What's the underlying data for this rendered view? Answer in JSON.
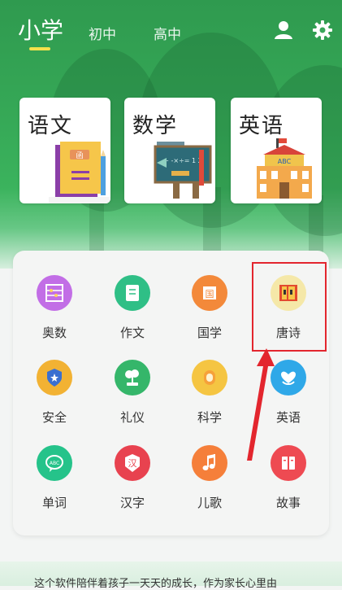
{
  "header": {
    "tabs": [
      {
        "label": "小学",
        "active": true
      },
      {
        "label": "初中",
        "active": false
      },
      {
        "label": "高中",
        "active": false
      }
    ],
    "icons": [
      "user-icon",
      "gear-icon"
    ]
  },
  "subjects": [
    {
      "title": "语文",
      "icon": "books-icon"
    },
    {
      "title": "数学",
      "icon": "blackboard-icon"
    },
    {
      "title": "英语",
      "icon": "school-icon"
    }
  ],
  "book_label": "函",
  "school_sign": "ABC",
  "board_text": "+ -×÷= 1 2",
  "grid": [
    {
      "label": "奥数",
      "icon": "abacus-icon",
      "color": "#c26ee6"
    },
    {
      "label": "作文",
      "icon": "scroll-icon",
      "color": "#2fbf86"
    },
    {
      "label": "国学",
      "icon": "seal-icon",
      "color": "#f3893a"
    },
    {
      "label": "唐诗",
      "icon": "poetry-book-icon",
      "color": "#f5e8a8"
    },
    {
      "label": "安全",
      "icon": "shield-icon",
      "color": "#f2b233"
    },
    {
      "label": "礼仪",
      "icon": "bonsai-icon",
      "color": "#35b66a"
    },
    {
      "label": "科学",
      "icon": "lab-icon",
      "color": "#f5c542"
    },
    {
      "label": "英语",
      "icon": "heart-hand-icon",
      "color": "#2fa8e8"
    },
    {
      "label": "单词",
      "icon": "speech-bubble-icon",
      "color": "#25c38a"
    },
    {
      "label": "汉字",
      "icon": "badge-icon",
      "color": "#e8424f"
    },
    {
      "label": "儿歌",
      "icon": "music-note-icon",
      "color": "#f57f3a"
    },
    {
      "label": "故事",
      "icon": "storybook-icon",
      "color": "#ee4a52"
    }
  ],
  "glyphs": {
    "seal": "国",
    "badge": "汉",
    "bubble": "ABC"
  },
  "footer_text": "这个软件陪伴着孩子一天天的成长，作为家长心里由"
}
